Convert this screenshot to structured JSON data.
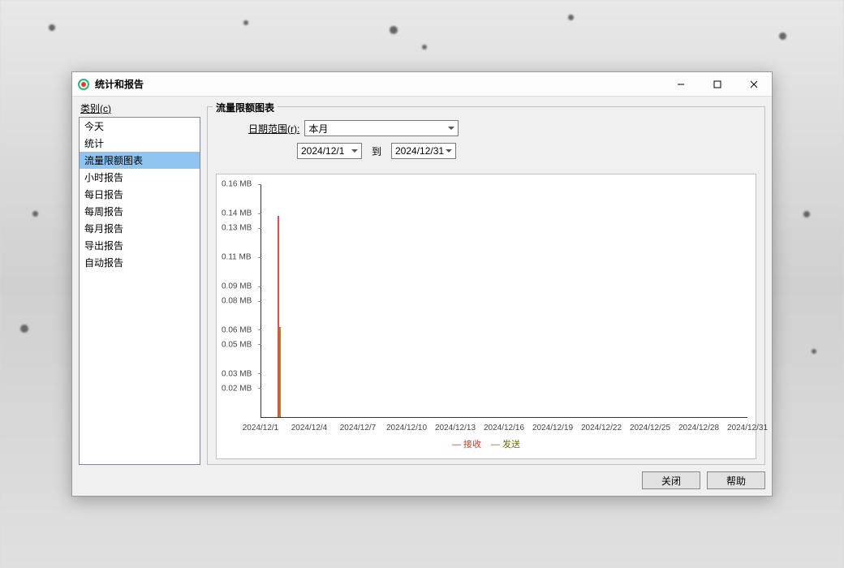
{
  "window": {
    "title": "统计和报告"
  },
  "sidebar": {
    "label_prefix": "类别(",
    "label_u": "c",
    "label_suffix": ")",
    "items": [
      {
        "label": "今天"
      },
      {
        "label": "统计"
      },
      {
        "label": "流量限额图表"
      },
      {
        "label": "小时报告"
      },
      {
        "label": "每日报告"
      },
      {
        "label": "每周报告"
      },
      {
        "label": "每月报告"
      },
      {
        "label": "导出报告"
      },
      {
        "label": "自动报告"
      }
    ],
    "selected_index": 2
  },
  "panel": {
    "title": "流量限额图表",
    "range_label_prefix": "日期范围(",
    "range_label_u": "r",
    "range_label_suffix": "):",
    "range_value": "本月",
    "to_label": "到",
    "date_from": "2024/12/1",
    "date_to": "2024/12/31"
  },
  "footer": {
    "close": "关闭",
    "help": "帮助"
  },
  "legend": {
    "recv": "— 接收",
    "send": "— 发送"
  },
  "chart_data": {
    "type": "bar",
    "title": "",
    "xlabel": "",
    "ylabel": "",
    "ylim": [
      0,
      0.16
    ],
    "y_unit": "MB",
    "y_ticks": [
      0.02,
      0.03,
      0.05,
      0.06,
      0.08,
      0.09,
      0.11,
      0.13,
      0.14,
      0.16
    ],
    "categories": [
      "2024/12/1",
      "2024/12/4",
      "2024/12/7",
      "2024/12/10",
      "2024/12/13",
      "2024/12/16",
      "2024/12/19",
      "2024/12/22",
      "2024/12/25",
      "2024/12/28",
      "2024/12/31"
    ],
    "series": [
      {
        "name": "接收",
        "color": "#e84a4a",
        "points": [
          {
            "x": "2024/12/2",
            "value": 0.138
          }
        ]
      },
      {
        "name": "发送",
        "color": "#9e8a1a",
        "points": [
          {
            "x": "2024/12/2",
            "value": 0.062
          }
        ]
      }
    ]
  }
}
